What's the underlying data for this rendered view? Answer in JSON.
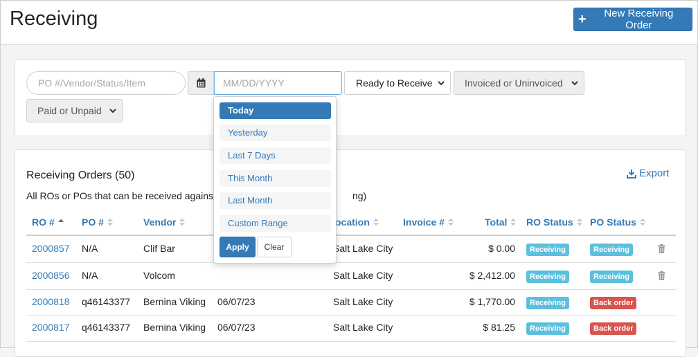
{
  "header": {
    "title": "Receiving",
    "new_button_label": "New Receiving Order"
  },
  "filters": {
    "search_placeholder": "PO #/Vendor/Status/Item",
    "date_placeholder": "MM/DD/YYYY",
    "receive_status": "Ready to Receive",
    "invoice_status": "Invoiced or Uninvoiced",
    "payment_status": "Paid or Unpaid"
  },
  "date_dropdown": {
    "items": [
      "Today",
      "Yesterday",
      "Last 7 Days",
      "This Month",
      "Last Month",
      "Custom Range"
    ],
    "active_index": 0,
    "apply_label": "Apply",
    "clear_label": "Clear"
  },
  "orders": {
    "title": "Receiving Orders (50)",
    "subtitle_left": "All ROs or POs that can be received against",
    "subtitle_right": "ng)",
    "export_label": "Export",
    "columns": {
      "ro": "RO #",
      "po": "PO #",
      "vendor": "Vendor",
      "location": "ocation",
      "invoice": "Invoice #",
      "total": "Total",
      "ro_status": "RO Status",
      "po_status": "PO Status"
    },
    "rows": [
      {
        "ro": "2000857",
        "po": "N/A",
        "vendor": "Clif Bar",
        "date": "",
        "location": "Salt Lake City",
        "total": "$ 0.00",
        "ro_status": "Receiving",
        "po_status": "Receiving",
        "po_status_color": "info",
        "deletable": true
      },
      {
        "ro": "2000856",
        "po": "N/A",
        "vendor": "Volcom",
        "date": "",
        "location": "Salt Lake City",
        "total": "$ 2,412.00",
        "ro_status": "Receiving",
        "po_status": "Receiving",
        "po_status_color": "info",
        "deletable": true
      },
      {
        "ro": "2000818",
        "po": "q46143377",
        "vendor": "Bernina Viking",
        "date": "06/07/23",
        "location": "Salt Lake City",
        "total": "$ 1,770.00",
        "ro_status": "Receiving",
        "po_status": "Back order",
        "po_status_color": "danger",
        "deletable": false
      },
      {
        "ro": "2000817",
        "po": "q46143377",
        "vendor": "Bernina Viking",
        "date": "06/07/23",
        "location": "Salt Lake City",
        "total": "$ 81.25",
        "ro_status": "Receiving",
        "po_status": "Back order",
        "po_status_color": "danger",
        "deletable": false
      }
    ]
  },
  "colors": {
    "primary": "#337ab7",
    "info": "#5bc0de",
    "danger": "#d9534f"
  }
}
